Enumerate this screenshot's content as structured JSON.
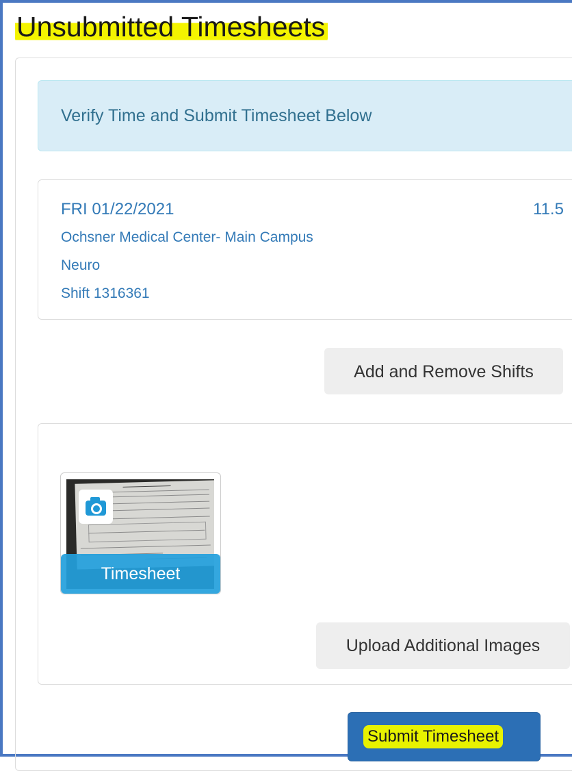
{
  "page": {
    "title": "Unsubmitted Timesheets"
  },
  "alert": {
    "message": "Verify Time and Submit Timesheet Below"
  },
  "shift": {
    "date": "FRI 01/22/2021",
    "hours": "11.5",
    "facility": "Ochsner Medical Center- Main Campus",
    "unit": "Neuro",
    "shift_id": "Shift 1316361"
  },
  "buttons": {
    "add_remove_shifts": "Add and Remove Shifts",
    "upload_images": "Upload Additional Images",
    "submit": "Submit Timesheet"
  },
  "images": {
    "thumbnail_label": "Timesheet",
    "thumbnail_icon": "camera-icon"
  },
  "colors": {
    "link_blue": "#337ab7",
    "alert_bg": "#d9edf7",
    "primary_button": "#2c6fb5",
    "highlight": "#f4f400",
    "camera_blue": "#1f98d6"
  }
}
